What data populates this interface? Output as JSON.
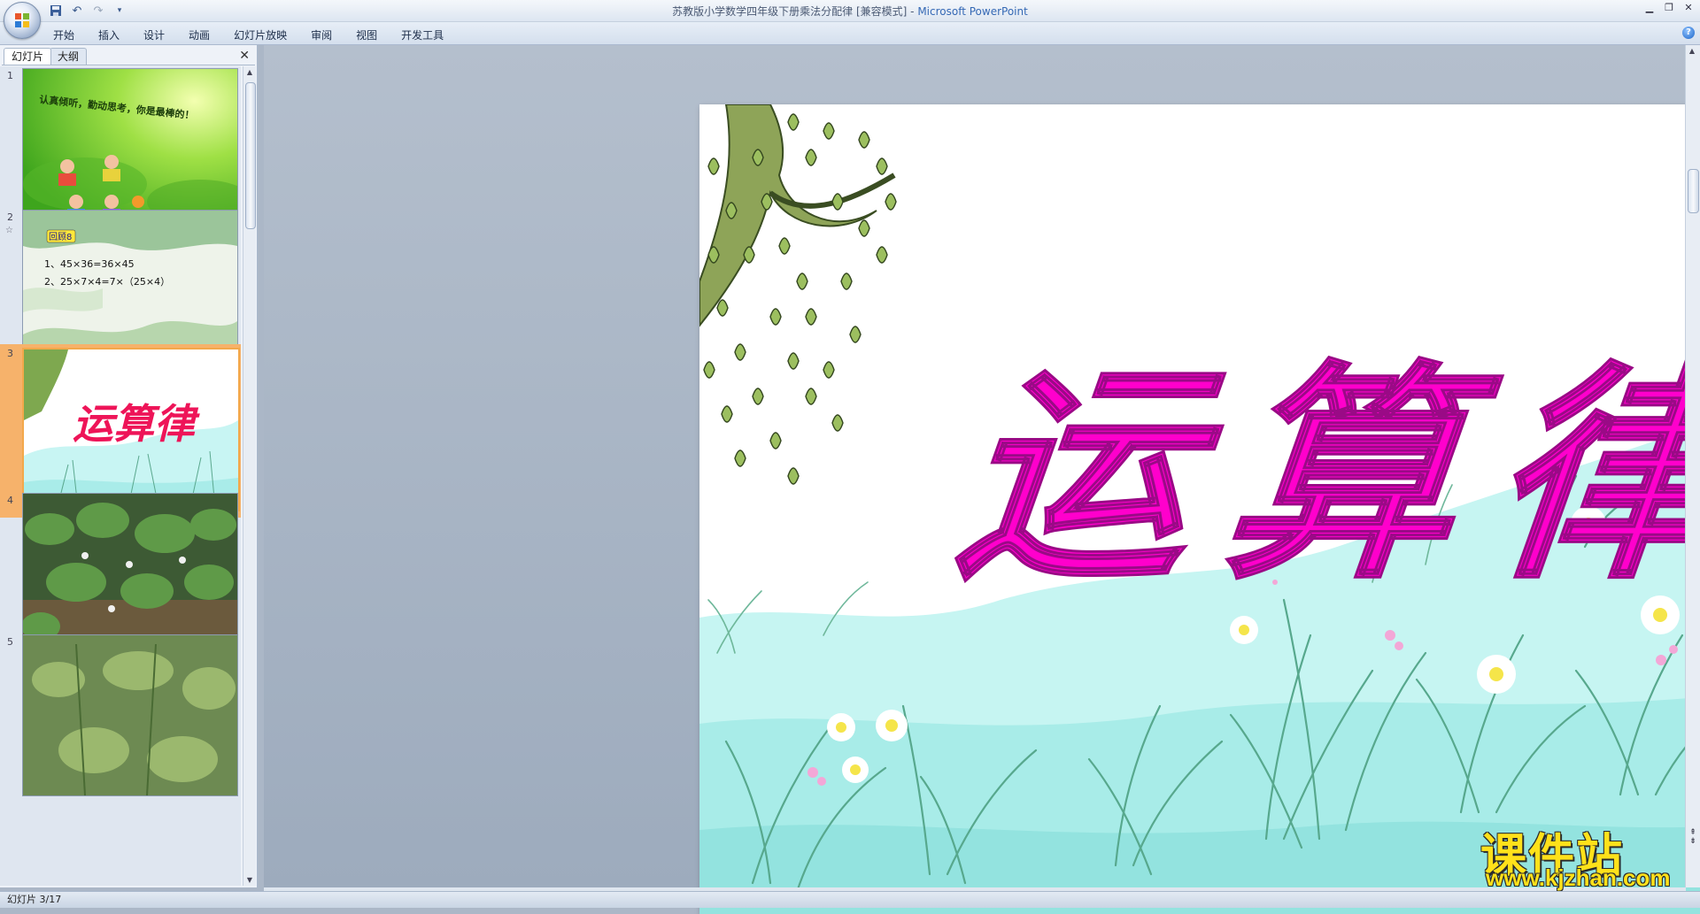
{
  "window": {
    "title_doc": "苏教版小学数学四年级下册乘法分配律 [兼容模式]",
    "title_sep": " - ",
    "title_app": "Microsoft PowerPoint",
    "controls": [
      "▁",
      "❐",
      "✕"
    ]
  },
  "qat": {
    "save": "save-icon",
    "undo": "↶",
    "redo": "↷",
    "more": "▾"
  },
  "ribbon": {
    "tabs": [
      "开始",
      "插入",
      "设计",
      "动画",
      "幻灯片放映",
      "审阅",
      "视图",
      "开发工具"
    ],
    "help": "?"
  },
  "left_pane": {
    "tabs": [
      "幻灯片",
      "大纲"
    ],
    "close": "✕",
    "slides": [
      {
        "num": "1",
        "title": "认真倾听，勤动思考，你是最棒的！"
      },
      {
        "num": "2",
        "star": "☆",
        "badge": "回顾8",
        "line1": "1、45×36=36×45",
        "line2": "2、25×7×4=7×（25×4）"
      },
      {
        "num": "3",
        "title": "运算律"
      },
      {
        "num": "4"
      },
      {
        "num": "5"
      }
    ],
    "selected": "3"
  },
  "slide": {
    "title": "运算律",
    "title_color": "#ff00cc"
  },
  "status": {
    "text": "幻灯片 3/17"
  },
  "watermark": {
    "text": "课件站",
    "url": "www.kjzhan.com",
    "color": "#ffe11a"
  },
  "colors": {
    "ribbon": "#dfe7f2",
    "selected_thumb": "#f6b26b",
    "sky": "#c6f5f2",
    "grass": "#57a88d"
  }
}
